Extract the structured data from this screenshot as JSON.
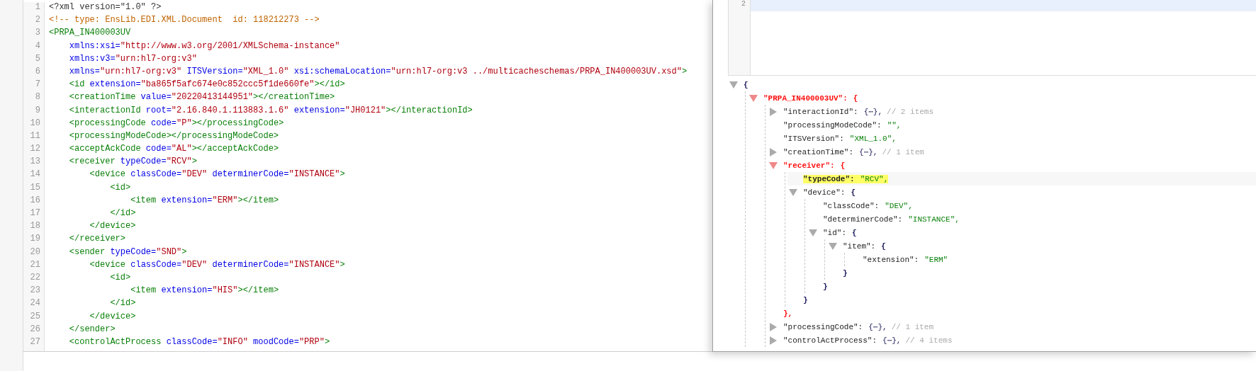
{
  "xml_editor": {
    "lines": [
      {
        "number": "1",
        "tokens": [
          {
            "kind": "pi",
            "text": "<?xml version=\"1.0\" ?>"
          }
        ]
      },
      {
        "number": "2",
        "tokens": [
          {
            "kind": "comment",
            "text": "<!-- type: EnsLib.EDI.XML.Document  id: 118212273 -->"
          }
        ]
      },
      {
        "number": "3",
        "tokens": [
          {
            "kind": "tag",
            "text": "<PRPA_IN400003UV"
          }
        ]
      },
      {
        "number": "4",
        "tokens": [
          {
            "kind": "attr",
            "text": "    xmlns:xsi="
          },
          {
            "kind": "value",
            "text": "\"http://www.w3.org/2001/XMLSchema-instance\""
          }
        ]
      },
      {
        "number": "5",
        "tokens": [
          {
            "kind": "attr",
            "text": "    xmlns:v3="
          },
          {
            "kind": "value",
            "text": "\"urn:hl7-org:v3\""
          }
        ]
      },
      {
        "number": "6",
        "tokens": [
          {
            "kind": "attr",
            "text": "    xmlns="
          },
          {
            "kind": "value",
            "text": "\"urn:hl7-org:v3\""
          },
          {
            "kind": "attr",
            "text": " ITSVersion="
          },
          {
            "kind": "value",
            "text": "\"XML_1.0\""
          },
          {
            "kind": "attr",
            "text": " xsi:schemaLocation="
          },
          {
            "kind": "value",
            "text": "\"urn:hl7-org:v3 ../multicacheschemas/PRPA_IN400003UV.xsd\""
          },
          {
            "kind": "tag",
            "text": ">"
          }
        ]
      },
      {
        "number": "7",
        "tokens": [
          {
            "kind": "tag",
            "text": "    <id"
          },
          {
            "kind": "attr",
            "text": " extension="
          },
          {
            "kind": "value",
            "text": "\"ba865f5afc674e0c852ccc5f1de660fe\""
          },
          {
            "kind": "tag",
            "text": "></id>"
          }
        ]
      },
      {
        "number": "8",
        "tokens": [
          {
            "kind": "tag",
            "text": "    <creationTime"
          },
          {
            "kind": "attr",
            "text": " value="
          },
          {
            "kind": "value",
            "text": "\"20220413144951\""
          },
          {
            "kind": "tag",
            "text": "></creationTime>"
          }
        ]
      },
      {
        "number": "9",
        "tokens": [
          {
            "kind": "tag",
            "text": "    <interactionId"
          },
          {
            "kind": "attr",
            "text": " root="
          },
          {
            "kind": "value",
            "text": "\"2.16.840.1.113883.1.6\""
          },
          {
            "kind": "attr",
            "text": " extension="
          },
          {
            "kind": "value",
            "text": "\"JH0121\""
          },
          {
            "kind": "tag",
            "text": "></interactionId>"
          }
        ]
      },
      {
        "number": "10",
        "tokens": [
          {
            "kind": "tag",
            "text": "    <processingCode"
          },
          {
            "kind": "attr",
            "text": " code="
          },
          {
            "kind": "value",
            "text": "\"P\""
          },
          {
            "kind": "tag",
            "text": "></processingCode>"
          }
        ]
      },
      {
        "number": "11",
        "tokens": [
          {
            "kind": "tag",
            "text": "    <processingModeCode></processingModeCode>"
          }
        ]
      },
      {
        "number": "12",
        "tokens": [
          {
            "kind": "tag",
            "text": "    <acceptAckCode"
          },
          {
            "kind": "attr",
            "text": " code="
          },
          {
            "kind": "value",
            "text": "\"AL\""
          },
          {
            "kind": "tag",
            "text": "></acceptAckCode>"
          }
        ]
      },
      {
        "number": "13",
        "tokens": [
          {
            "kind": "tag",
            "text": "    <receiver"
          },
          {
            "kind": "attr",
            "text": " typeCode="
          },
          {
            "kind": "value",
            "text": "\"RCV\""
          },
          {
            "kind": "tag",
            "text": ">"
          }
        ]
      },
      {
        "number": "14",
        "tokens": [
          {
            "kind": "tag",
            "text": "        <device"
          },
          {
            "kind": "attr",
            "text": " classCode="
          },
          {
            "kind": "value",
            "text": "\"DEV\""
          },
          {
            "kind": "attr",
            "text": " determinerCode="
          },
          {
            "kind": "value",
            "text": "\"INSTANCE\""
          },
          {
            "kind": "tag",
            "text": ">"
          }
        ]
      },
      {
        "number": "15",
        "tokens": [
          {
            "kind": "tag",
            "text": "            <id>"
          }
        ]
      },
      {
        "number": "16",
        "tokens": [
          {
            "kind": "tag",
            "text": "                <item"
          },
          {
            "kind": "attr",
            "text": " extension="
          },
          {
            "kind": "value",
            "text": "\"ERM\""
          },
          {
            "kind": "tag",
            "text": "></item>"
          }
        ]
      },
      {
        "number": "17",
        "tokens": [
          {
            "kind": "tag",
            "text": "            </id>"
          }
        ]
      },
      {
        "number": "18",
        "tokens": [
          {
            "kind": "tag",
            "text": "        </device>"
          }
        ]
      },
      {
        "number": "19",
        "tokens": [
          {
            "kind": "tag",
            "text": "    </receiver>"
          }
        ]
      },
      {
        "number": "20",
        "tokens": [
          {
            "kind": "tag",
            "text": "    <sender"
          },
          {
            "kind": "attr",
            "text": " typeCode="
          },
          {
            "kind": "value",
            "text": "\"SND\""
          },
          {
            "kind": "tag",
            "text": ">"
          }
        ]
      },
      {
        "number": "21",
        "tokens": [
          {
            "kind": "tag",
            "text": "        <device"
          },
          {
            "kind": "attr",
            "text": " classCode="
          },
          {
            "kind": "value",
            "text": "\"DEV\""
          },
          {
            "kind": "attr",
            "text": " determinerCode="
          },
          {
            "kind": "value",
            "text": "\"INSTANCE\""
          },
          {
            "kind": "tag",
            "text": ">"
          }
        ]
      },
      {
        "number": "22",
        "tokens": [
          {
            "kind": "tag",
            "text": "            <id>"
          }
        ]
      },
      {
        "number": "23",
        "tokens": [
          {
            "kind": "tag",
            "text": "                <item"
          },
          {
            "kind": "attr",
            "text": " extension="
          },
          {
            "kind": "value",
            "text": "\"HIS\""
          },
          {
            "kind": "tag",
            "text": "></item>"
          }
        ]
      },
      {
        "number": "24",
        "tokens": [
          {
            "kind": "tag",
            "text": "            </id>"
          }
        ]
      },
      {
        "number": "25",
        "tokens": [
          {
            "kind": "tag",
            "text": "        </device>"
          }
        ]
      },
      {
        "number": "26",
        "tokens": [
          {
            "kind": "tag",
            "text": "    </sender>"
          }
        ]
      },
      {
        "number": "27",
        "tokens": [
          {
            "kind": "tag",
            "text": "    <controlActProcess"
          },
          {
            "kind": "attr",
            "text": " classCode="
          },
          {
            "kind": "value",
            "text": "\"INFO\""
          },
          {
            "kind": "attr",
            "text": " moodCode="
          },
          {
            "kind": "value",
            "text": "\"PRP\""
          },
          {
            "kind": "tag",
            "text": ">"
          }
        ]
      }
    ]
  },
  "json_editor": {
    "lines": [
      {
        "number": "2",
        "current": true
      }
    ]
  },
  "json_view": {
    "root": {
      "kind": "object",
      "open": "{",
      "expanded": true,
      "emphasized": false,
      "selected": false,
      "children": [
        {
          "kind": "object",
          "key": "\"PRPA_IN400003UV\":",
          "open": "{",
          "expanded": true,
          "emphasized": true,
          "selected": false,
          "children": [
            {
              "kind": "object",
              "key": "\"interactionId\":",
              "value": "{⋯},",
              "comment": "// 2 items",
              "expanded": false,
              "emphasized": false,
              "selected": false
            },
            {
              "kind": "leaf",
              "key": "\"processingModeCode\":",
              "value": "\"\",",
              "selected": false
            },
            {
              "kind": "leaf",
              "key": "\"ITSVersion\":",
              "value": "\"XML_1.0\",",
              "selected": false
            },
            {
              "kind": "object",
              "key": "\"creationTime\":",
              "value": "{⋯},",
              "comment": "// 1 item",
              "expanded": false,
              "emphasized": false,
              "selected": false
            },
            {
              "kind": "object",
              "key": "\"receiver\":",
              "open": "{",
              "close": "},",
              "expanded": true,
              "emphasized": true,
              "selected": false,
              "children": [
                {
                  "kind": "leaf",
                  "key": "\"typeCode\":",
                  "value": "\"RCV\",",
                  "selected": true
                },
                {
                  "kind": "object",
                  "key": "\"device\":",
                  "open": "{",
                  "close": "}",
                  "expanded": true,
                  "emphasized": false,
                  "selected": false,
                  "children": [
                    {
                      "kind": "leaf",
                      "key": "\"classCode\":",
                      "value": "\"DEV\",",
                      "selected": false
                    },
                    {
                      "kind": "leaf",
                      "key": "\"determinerCode\":",
                      "value": "\"INSTANCE\",",
                      "selected": false
                    },
                    {
                      "kind": "object",
                      "key": "\"id\":",
                      "open": "{",
                      "close": "}",
                      "expanded": true,
                      "emphasized": false,
                      "selected": false,
                      "children": [
                        {
                          "kind": "object",
                          "key": "\"item\":",
                          "open": "{",
                          "close": "}",
                          "expanded": true,
                          "emphasized": false,
                          "selected": false,
                          "children": [
                            {
                              "kind": "leaf",
                              "key": "\"extension\":",
                              "value": "\"ERM\"",
                              "selected": false
                            }
                          ]
                        }
                      ]
                    }
                  ]
                }
              ]
            },
            {
              "kind": "object",
              "key": "\"processingCode\":",
              "value": "{⋯},",
              "comment": "// 1 item",
              "expanded": false,
              "emphasized": false,
              "selected": false
            },
            {
              "kind": "object",
              "key": "\"controlActProcess\":",
              "value": "{⋯},",
              "comment": "// 4 items",
              "expanded": false,
              "emphasized": false,
              "selected": false
            }
          ]
        }
      ]
    }
  }
}
